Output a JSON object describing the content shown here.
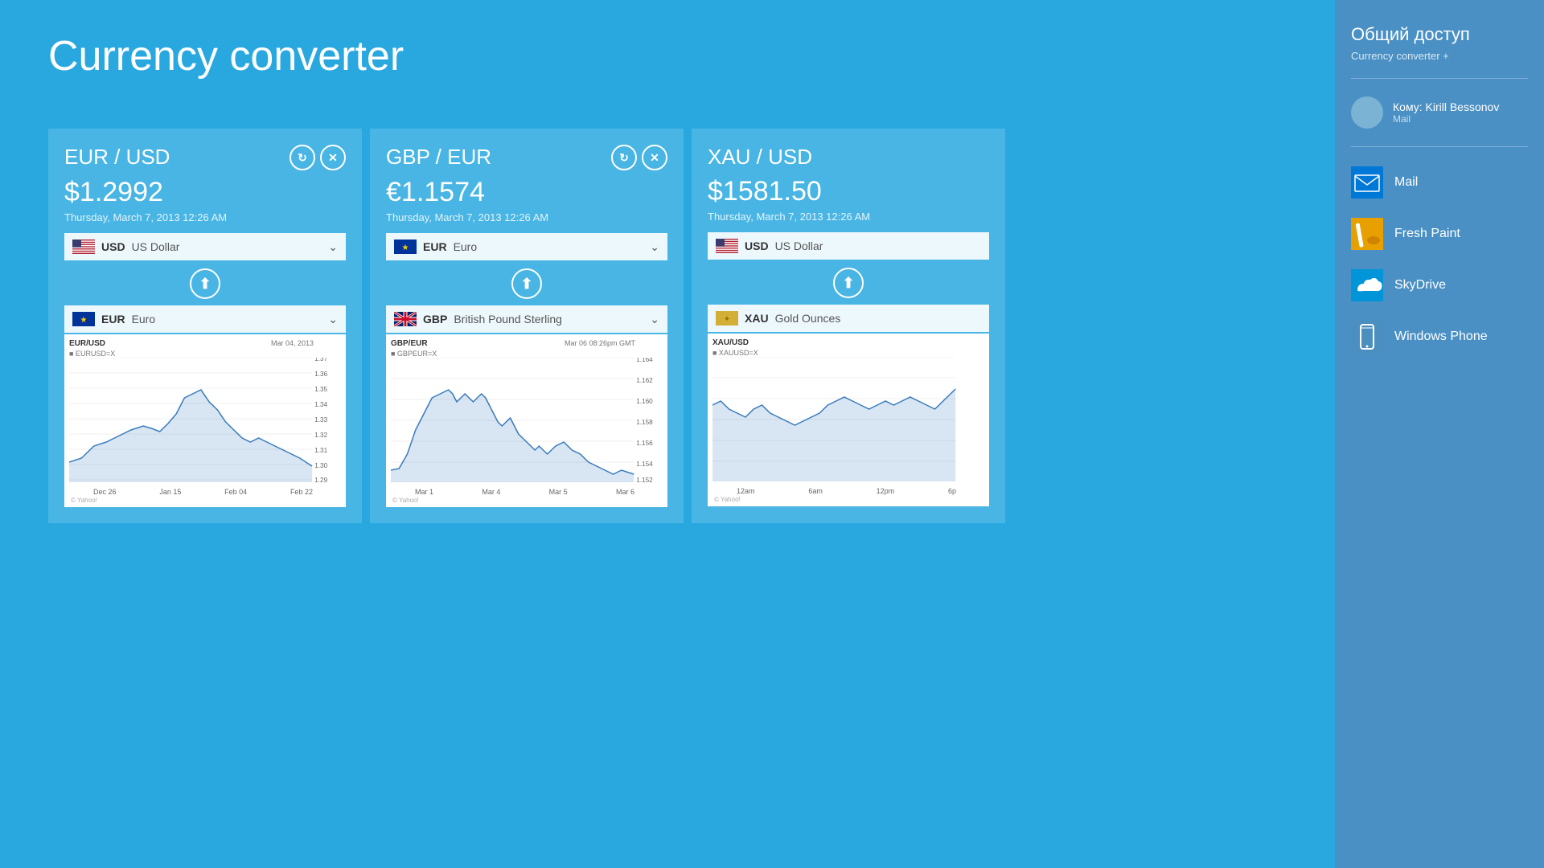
{
  "app": {
    "title": "Currency converter"
  },
  "cards": [
    {
      "id": "eur-usd",
      "pair": "EUR / USD",
      "rate": "$1.2992",
      "date": "Thursday, March 7, 2013 12:26 AM",
      "from_flag": "us",
      "from_code": "USD",
      "from_name": "US Dollar",
      "to_flag": "eu",
      "to_code": "EUR",
      "to_name": "Euro",
      "chart_title": "EUR/USD",
      "chart_sub": "■ EURUSD=X",
      "chart_date": "Mar 04, 2013",
      "chart_y": [
        "1.37",
        "1.36",
        "1.35",
        "1.34",
        "1.33",
        "1.32",
        "1.31",
        "1.30",
        "1.29"
      ],
      "chart_x": [
        "Dec 26",
        "Jan 15",
        "Feb 04",
        "Feb 22"
      ]
    },
    {
      "id": "gbp-eur",
      "pair": "GBP / EUR",
      "rate": "€1.1574",
      "date": "Thursday, March 7, 2013 12:26 AM",
      "from_flag": "eu",
      "from_code": "EUR",
      "from_name": "Euro",
      "to_flag": "gb",
      "to_code": "GBP",
      "to_name": "British Pound Sterling",
      "chart_title": "GBP/EUR",
      "chart_sub": "■ GBPEUR=X",
      "chart_date": "Mar 06 08:26pm GMT",
      "chart_y": [
        "1.164",
        "1.162",
        "1.160",
        "1.158",
        "1.156",
        "1.154",
        "1.152"
      ],
      "chart_x": [
        "Mar 1",
        "Mar 4",
        "Mar 5",
        "Mar 6"
      ]
    },
    {
      "id": "xau-usd",
      "pair": "XAU / USD",
      "rate": "$1581.50",
      "date": "Thursday, March 7, 2013 12:26 AM",
      "from_flag": "us",
      "from_code": "USD",
      "from_name": "US Dollar",
      "to_flag": "gold",
      "to_code": "XAU",
      "to_name": "Gold Ounces",
      "chart_title": "XAU/USD",
      "chart_sub": "■ XAUUSD=X",
      "chart_date": "",
      "chart_y": [],
      "chart_x": [
        "12am",
        "6am",
        "12pm",
        "6p"
      ]
    }
  ],
  "sidebar": {
    "title": "Общий доступ",
    "subtitle": "Currency converter +",
    "contact": {
      "name": "Кому: Kirill Bessonov",
      "app": "Mail"
    },
    "apps": [
      {
        "id": "mail",
        "name": "Mail",
        "color": "#0078d7"
      },
      {
        "id": "fresh-paint",
        "name": "Fresh Paint",
        "color": "#e8a000"
      },
      {
        "id": "skydrive",
        "name": "SkyDrive",
        "color": "#0078d7"
      },
      {
        "id": "windows-phone",
        "name": "Windows Phone",
        "color": "#4a8fc0"
      }
    ]
  }
}
